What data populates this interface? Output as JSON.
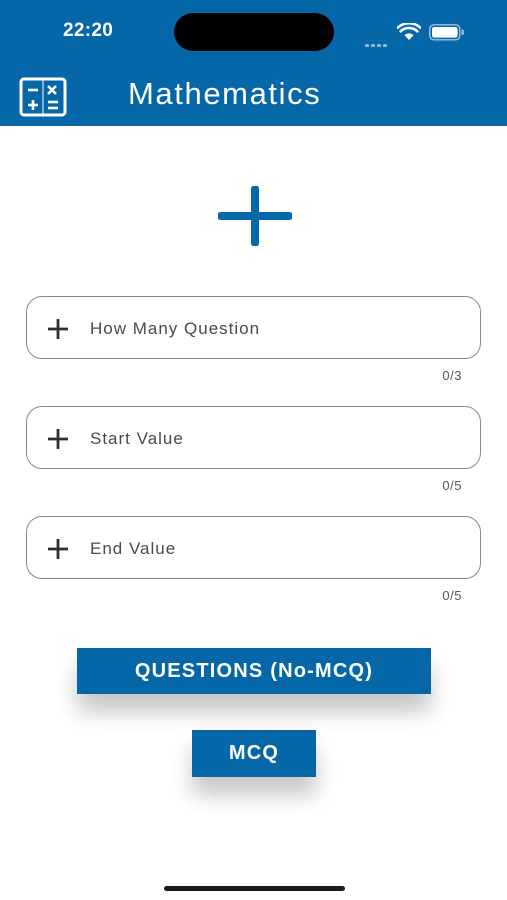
{
  "status_bar": {
    "time": "22:20",
    "icons": [
      "cellular-signal-icon",
      "wifi-icon",
      "battery-icon"
    ]
  },
  "app_bar": {
    "logo_icon": "calculator-icon",
    "title": "Mathematics"
  },
  "operation": {
    "icon": "plus-icon"
  },
  "fields": [
    {
      "icon": "plus-icon",
      "placeholder": "How Many Question",
      "counter": "0/3"
    },
    {
      "icon": "plus-icon",
      "placeholder": "Start Value",
      "counter": "0/5"
    },
    {
      "icon": "plus-icon",
      "placeholder": "End Value",
      "counter": "0/5"
    }
  ],
  "buttons": {
    "questions_label": "QUESTIONS (No-MCQ)",
    "mcq_label": "MCQ"
  },
  "colors": {
    "primary": "#0567a7",
    "background": "#ffffff",
    "icon_dark": "#2e2e2e"
  }
}
